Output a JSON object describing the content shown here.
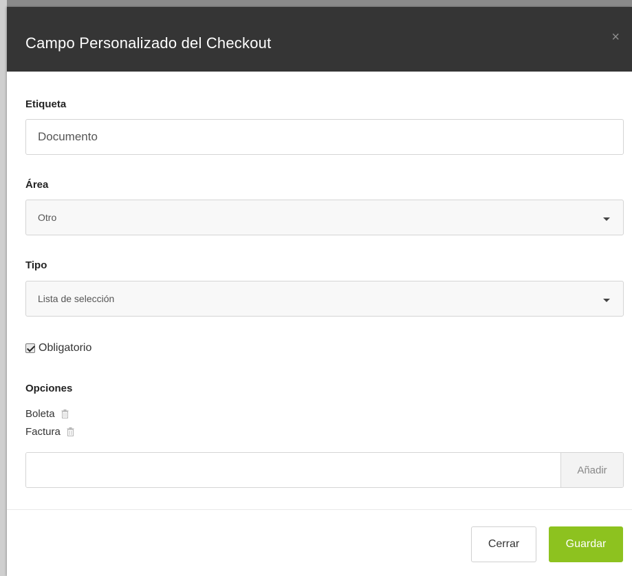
{
  "modal": {
    "title": "Campo Personalizado del Checkout",
    "close_glyph": "×"
  },
  "form": {
    "label_field": {
      "label": "Etiqueta",
      "value": "Documento"
    },
    "area_field": {
      "label": "Área",
      "selected": "Otro"
    },
    "type_field": {
      "label": "Tipo",
      "selected": "Lista de selección"
    },
    "required": {
      "label": "Obligatorio",
      "checked": true
    },
    "options": {
      "label": "Opciones",
      "items": [
        {
          "text": "Boleta",
          "icon": "trash-icon"
        },
        {
          "text": "Factura",
          "icon": "trash-icon"
        }
      ],
      "add_value": "",
      "add_button": "Añadir"
    }
  },
  "footer": {
    "close_label": "Cerrar",
    "save_label": "Guardar"
  },
  "colors": {
    "header_bg": "#353535",
    "save_button": "#8dc21f"
  }
}
